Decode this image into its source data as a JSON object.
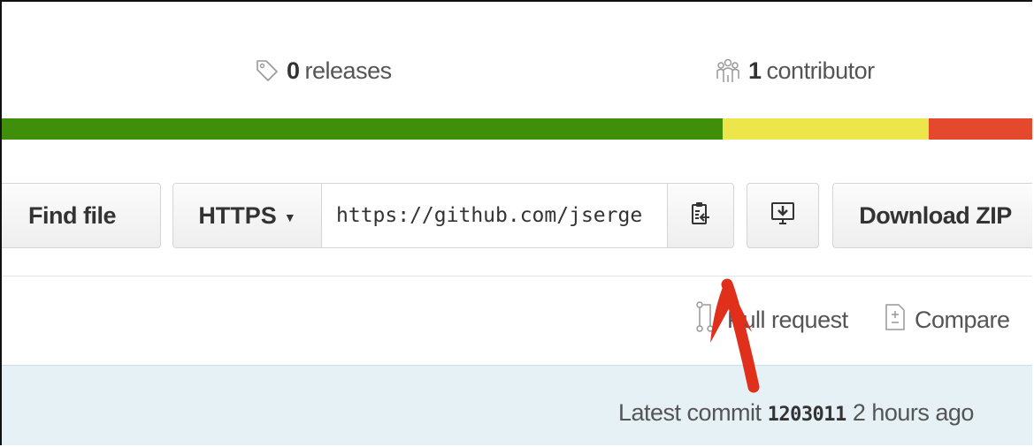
{
  "summary": {
    "releases_count": "0",
    "releases_label": "releases",
    "contributors_count": "1",
    "contributors_label": "contributor"
  },
  "language_bar": {
    "segments": [
      {
        "color": "#3f8f0a",
        "fraction": 0.7
      },
      {
        "color": "#ede64a",
        "fraction": 0.2
      },
      {
        "color": "#e4482d",
        "fraction": 0.1
      }
    ]
  },
  "toolbar": {
    "find_file_label": "Find file",
    "clone_protocol": "HTTPS",
    "clone_url": "https://github.com/jserge",
    "download_zip_label": "Download ZIP"
  },
  "actions": {
    "pull_request_label": "Pull request",
    "compare_label": "Compare"
  },
  "commit": {
    "prefix": "Latest commit",
    "sha": "1203011",
    "time": "2 hours ago"
  },
  "colors": {
    "annotation_arrow": "#e0301c",
    "commit_background": "#e6f1f6"
  },
  "icons": {
    "releases": "tag-icon",
    "contributors": "organization-icon",
    "protocol_dropdown": "caret-down-icon",
    "copy": "clippy-icon",
    "desktop": "desktop-download-icon",
    "pull_request": "git-pull-request-icon",
    "compare": "diff-icon"
  }
}
